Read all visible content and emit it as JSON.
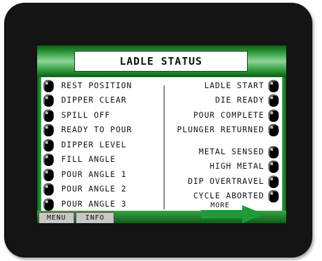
{
  "title": "LADLE STATUS",
  "left_items": [
    {
      "label": "REST POSITION"
    },
    {
      "label": "DIPPER CLEAR"
    },
    {
      "label": "SPILL OFF"
    },
    {
      "label": "READY TO POUR"
    },
    {
      "label": "DIPPER LEVEL"
    },
    {
      "label": "FILL ANGLE"
    },
    {
      "label": "POUR ANGLE 1"
    },
    {
      "label": "POUR ANGLE 2"
    },
    {
      "label": "POUR ANGLE 3"
    }
  ],
  "right_items": [
    {
      "label": "LADLE START"
    },
    {
      "label": "DIE READY"
    },
    {
      "label": "POUR COMPLETE"
    },
    {
      "label": "PLUNGER RETURNED"
    },
    {
      "label": "METAL SENSED"
    },
    {
      "label": "HIGH METAL"
    },
    {
      "label": "DIP OVERTRAVEL"
    },
    {
      "label": "CYCLE ABORTED"
    }
  ],
  "buttons": {
    "menu": "MENU",
    "info": "INFO",
    "more": "MORE"
  },
  "colors": {
    "bezel": "#141414",
    "header_green": "#2f9b3a",
    "arrow_green": "#1e9a3a",
    "indicator": "#000000"
  }
}
